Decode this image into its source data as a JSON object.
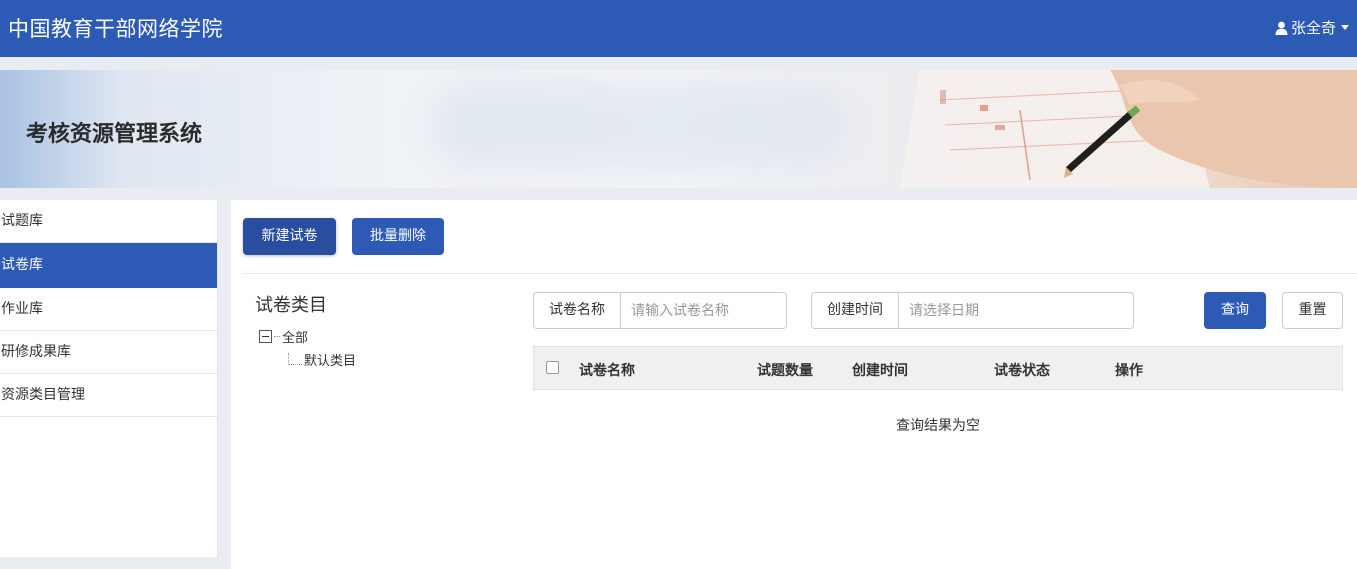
{
  "header": {
    "brand": "中国教育干部网络学院",
    "user_name": "张全奇"
  },
  "banner": {
    "title": "考核资源管理系统"
  },
  "sidebar": {
    "items": [
      {
        "label": "试题库",
        "active": false
      },
      {
        "label": "试卷库",
        "active": true
      },
      {
        "label": "作业库",
        "active": false
      },
      {
        "label": "研修成果库",
        "active": false
      },
      {
        "label": "资源类目管理",
        "active": false
      }
    ]
  },
  "toolbar": {
    "new_label": "新建试卷",
    "batch_delete_label": "批量删除"
  },
  "category": {
    "title": "试卷类目",
    "root": "全部",
    "children": [
      "默认类目"
    ]
  },
  "search": {
    "name_label": "试卷名称",
    "name_placeholder": "请输入试卷名称",
    "date_label": "创建时间",
    "date_placeholder": "请选择日期",
    "query_label": "查询",
    "reset_label": "重置"
  },
  "table": {
    "columns": [
      "试卷名称",
      "试题数量",
      "创建时间",
      "试卷状态",
      "操作"
    ],
    "empty_text": "查询结果为空"
  },
  "colors": {
    "primary": "#2d5ab5",
    "primary_dark": "#2a4e9f"
  }
}
